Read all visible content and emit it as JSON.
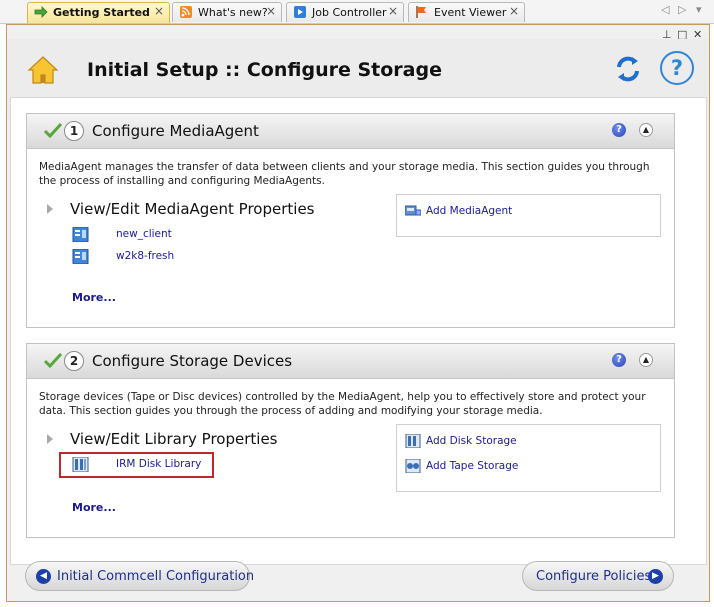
{
  "tabs": [
    {
      "label": "Getting Started",
      "active": true,
      "icon": "arrow-right-icon"
    },
    {
      "label": "What's new?",
      "active": false,
      "icon": "rss-icon"
    },
    {
      "label": "Job Controller",
      "active": false,
      "icon": "play-icon"
    },
    {
      "label": "Event Viewer",
      "active": false,
      "icon": "flag-icon"
    }
  ],
  "tab_close": "×",
  "tab_nav": {
    "prev": "◁",
    "next": "▷",
    "menu": "▾"
  },
  "window_controls": {
    "pin": "⊥",
    "restore": "□",
    "close": "✕"
  },
  "header": {
    "title": "Initial Setup :: Configure Storage"
  },
  "help_glyph": "?",
  "sections": [
    {
      "number": "1",
      "title": "Configure MediaAgent",
      "description": "MediaAgent manages the transfer of data between clients and your storage media. This section guides you through the process of installing and configuring MediaAgents.",
      "subtitle": "View/Edit MediaAgent Properties",
      "items": [
        "new_client",
        "w2k8-fresh"
      ],
      "more": "More...",
      "actions": [
        "Add MediaAgent"
      ]
    },
    {
      "number": "2",
      "title": "Configure Storage Devices",
      "description": "Storage devices (Tape or Disc devices) controlled by the MediaAgent, help you to effectively store and protect your data. This section guides you through the process of adding and modifying your storage media.",
      "subtitle": "View/Edit Library Properties",
      "items": [
        "IRM Disk Library"
      ],
      "more": "More...",
      "actions": [
        "Add Disk Storage",
        "Add Tape Storage"
      ]
    }
  ],
  "nav": {
    "back_label": "Initial Commcell Configuration",
    "next_label": "Configure Policies"
  },
  "colors": {
    "accent": "#1f3fa8",
    "link": "#1a1a9c",
    "highlight": "#c0262c",
    "active_tab": "#f7e59a"
  }
}
